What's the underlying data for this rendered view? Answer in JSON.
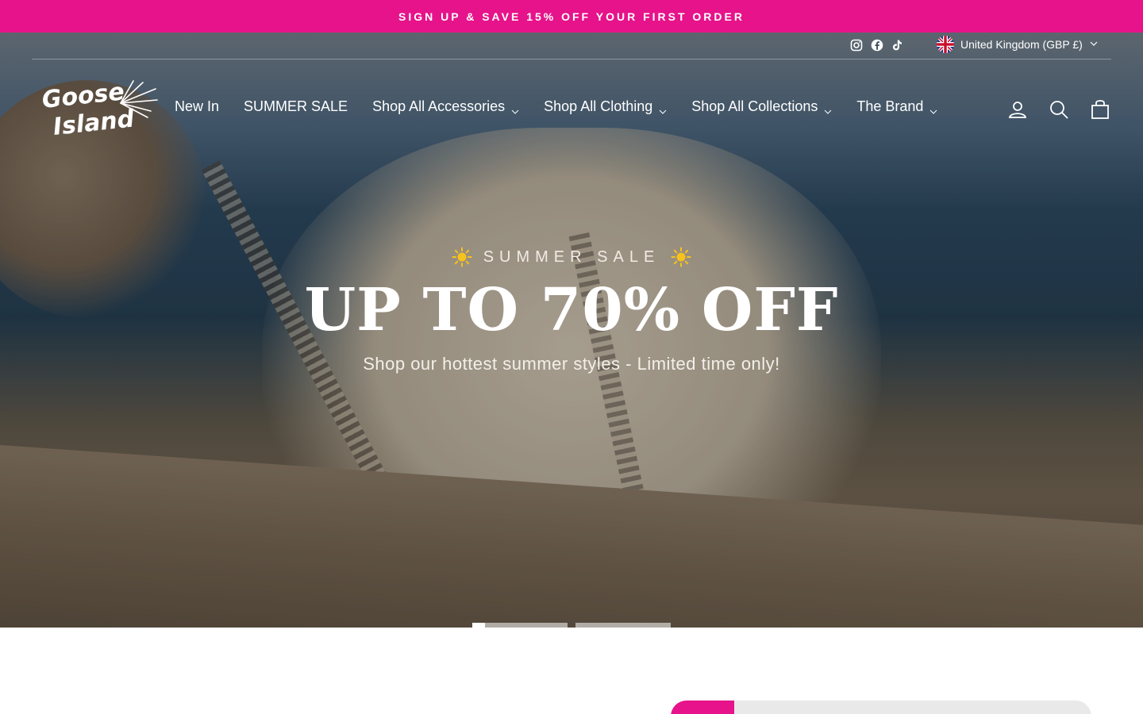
{
  "announcement": {
    "text": "SIGN UP & SAVE 15% OFF YOUR FIRST ORDER"
  },
  "colors": {
    "accent": "#e6138a",
    "text_on_hero": "#ffffff"
  },
  "utility": {
    "socials": [
      {
        "name": "instagram-icon"
      },
      {
        "name": "facebook-icon"
      },
      {
        "name": "tiktok-icon"
      }
    ],
    "locale": {
      "label": "United Kingdom (GBP £)",
      "flag": "uk-flag-icon"
    }
  },
  "header": {
    "logo_text": "Goose Island",
    "nav": [
      {
        "label": "New In",
        "has_dropdown": false
      },
      {
        "label": "SUMMER SALE",
        "has_dropdown": false
      },
      {
        "label": "Shop All Accessories",
        "has_dropdown": true
      },
      {
        "label": "Shop All Clothing",
        "has_dropdown": true
      },
      {
        "label": "Shop All Collections",
        "has_dropdown": true
      },
      {
        "label": "The Brand",
        "has_dropdown": true
      }
    ],
    "actions": [
      "account-icon",
      "search-icon",
      "cart-icon"
    ]
  },
  "hero": {
    "eyebrow": "SUMMER SALE",
    "headline": "UP TO 70% OFF",
    "subline": "Shop our hottest summer styles - Limited time only!",
    "slides_total": 2,
    "active_slide_progress": 0.13
  }
}
